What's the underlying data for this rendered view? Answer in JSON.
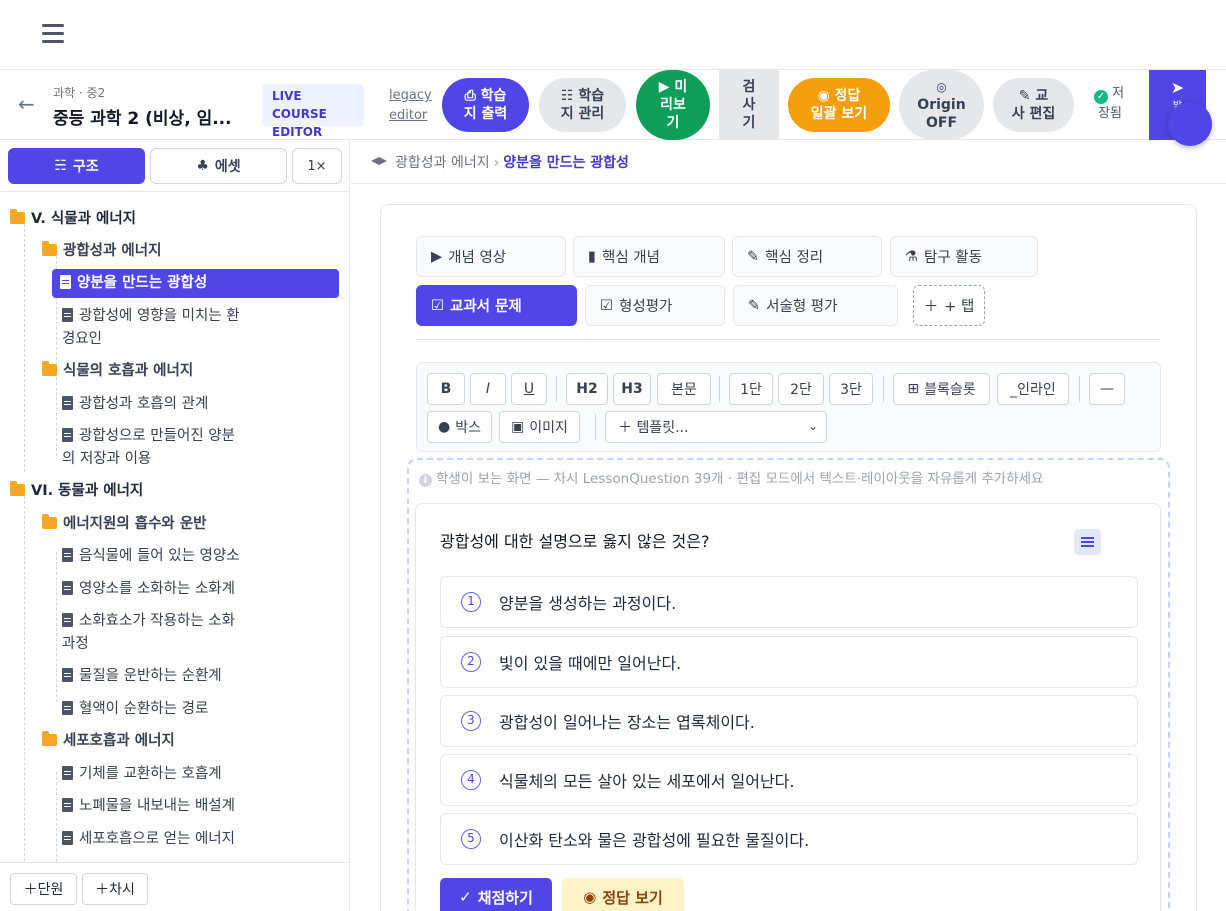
{
  "header": {
    "course_sub": "과학 · 중2",
    "course_title": "중등 과학 2 (비상, 임...",
    "live_badge_1": "LIVE COURSE",
    "live_badge_2": "EDITOR",
    "legacy_1": "legacy",
    "legacy_2": "editor",
    "print_1": "학습",
    "print_2": "지 출력",
    "manage_1": "학습",
    "manage_2": "지 관리",
    "preview_1": "미",
    "preview_2": "리보",
    "preview_3": "기",
    "check_1": "검",
    "check_2": "사",
    "check_3": "기",
    "answer_1": "정답",
    "answer_2": "일괄 보기",
    "origin_1": "Origin",
    "origin_2": "OFF",
    "editor_1": "교",
    "editor_2": "사 편집",
    "saved_1": "저",
    "saved_2": "장됨",
    "publish": "발"
  },
  "sidebar": {
    "struct_label": "구조",
    "asset_label": "에셋",
    "zoom_label": "1×",
    "tree": [
      {
        "label": "V. 식물과 에너지"
      },
      {
        "label": "광합성과 에너지"
      },
      {
        "label": "양분을 만드는 광합성"
      },
      {
        "label": "광합성에 영향을 미치는 환"
      },
      {
        "label": "경요인"
      },
      {
        "label": "식물의 호흡과 에너지"
      },
      {
        "label": "광합성과 호흡의 관계"
      },
      {
        "label": "광합성으로 만들어진 양분"
      },
      {
        "label": "의 저장과 이용"
      },
      {
        "label": "VI. 동물과 에너지"
      },
      {
        "label": "에너지원의 흡수와 운반"
      },
      {
        "label": "음식물에 들어 있는 영양소"
      },
      {
        "label": "영양소를 소화하는 소화계"
      },
      {
        "label": "소화효소가 작용하는 소화"
      },
      {
        "label": "과정"
      },
      {
        "label": "물질을 운반하는 순환계"
      },
      {
        "label": "혈액이 순환하는 경로"
      },
      {
        "label": "세포호흡과 에너지"
      },
      {
        "label": "기체를 교환하는 호흡계"
      },
      {
        "label": "노폐물을 내보내는 배설계"
      },
      {
        "label": "세포호흡으로 얻는 에너지"
      }
    ],
    "add_unit": "단원",
    "add_lesson": "차시"
  },
  "breadcrumb": {
    "parent": "광합성과 에너지",
    "current": "양분을 만드는 광합성"
  },
  "tabs": [
    {
      "label": "개념 영상"
    },
    {
      "label": "핵심 개념"
    },
    {
      "label": "핵심 정리"
    },
    {
      "label": "탐구 활동"
    },
    {
      "label": "교과서 문제"
    },
    {
      "label": "형성평가"
    },
    {
      "label": "서술형 평가"
    },
    {
      "label": "+ 탭"
    }
  ],
  "toolbar": {
    "bold": "B",
    "italic": "I",
    "underline": "U",
    "h2": "H2",
    "h3": "H3",
    "body": "본문",
    "col1": "1단",
    "col2": "2단",
    "col3": "3단",
    "blockslot": "블록슬롯",
    "inline": "_인라인",
    "hr": "—",
    "box": "박스",
    "image": "이미지",
    "template": "＋ 템플릿..."
  },
  "preview": {
    "hint": "학생이 보는 화면 — 차시 LessonQuestion 39개 · 편집 모드에서 텍스트·레이아웃을 자유롭게 추가하세요"
  },
  "question": {
    "text": "광합성에 대한 설명으로 옳지 않은 것은?",
    "options": [
      {
        "num": "1",
        "text": "양분을 생성하는 과정이다."
      },
      {
        "num": "2",
        "text": "빛이 있을 때에만 일어난다."
      },
      {
        "num": "3",
        "text": "광합성이 일어나는 장소는 엽록체이다."
      },
      {
        "num": "4",
        "text": "식물체의 모든 살아 있는 세포에서 일어난다."
      },
      {
        "num": "5",
        "text": "이산화 탄소와 물은 광합성에 필요한 물질이다."
      }
    ],
    "grade_label": "채점하기",
    "answer_label": "정답 보기"
  }
}
